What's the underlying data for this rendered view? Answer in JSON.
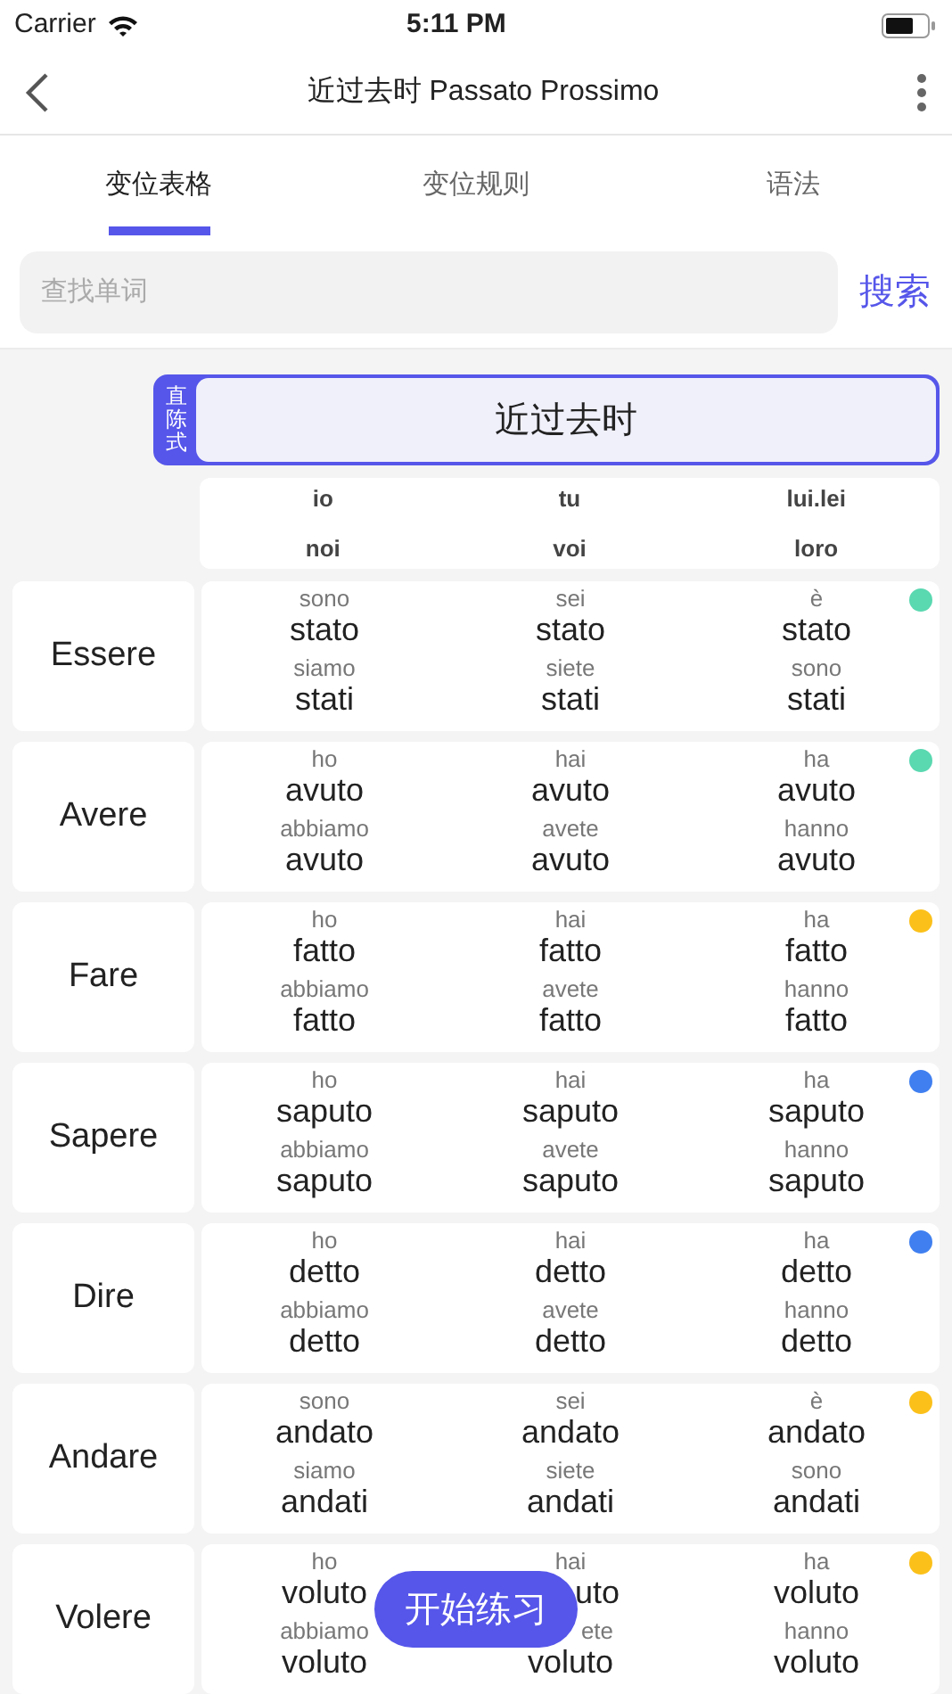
{
  "status_bar": {
    "carrier": "Carrier",
    "time": "5:11 PM"
  },
  "nav": {
    "title": "近过去时 Passato Prossimo"
  },
  "tabs": [
    {
      "label": "变位表格",
      "selected": true
    },
    {
      "label": "变位规则",
      "selected": false
    },
    {
      "label": "语法",
      "selected": false
    }
  ],
  "search": {
    "placeholder": "查找单词",
    "button": "搜索"
  },
  "mood": {
    "tag": "直陈式",
    "tense": "近过去时"
  },
  "persons": [
    [
      "io",
      "tu",
      "lui.lei"
    ],
    [
      "noi",
      "voi",
      "loro"
    ]
  ],
  "verbs": [
    {
      "name": "Essere",
      "color": "#5ad8b0",
      "forms": [
        [
          {
            "aux": "sono",
            "part": "stato"
          },
          {
            "aux": "sei",
            "part": "stato"
          },
          {
            "aux": "è",
            "part": "stato"
          }
        ],
        [
          {
            "aux": "siamo",
            "part": "stati"
          },
          {
            "aux": "siete",
            "part": "stati"
          },
          {
            "aux": "sono",
            "part": "stati"
          }
        ]
      ]
    },
    {
      "name": "Avere",
      "color": "#5ad8b0",
      "forms": [
        [
          {
            "aux": "ho",
            "part": "avuto"
          },
          {
            "aux": "hai",
            "part": "avuto"
          },
          {
            "aux": "ha",
            "part": "avuto"
          }
        ],
        [
          {
            "aux": "abbiamo",
            "part": "avuto"
          },
          {
            "aux": "avete",
            "part": "avuto"
          },
          {
            "aux": "hanno",
            "part": "avuto"
          }
        ]
      ]
    },
    {
      "name": "Fare",
      "color": "#fbc01a",
      "forms": [
        [
          {
            "aux": "ho",
            "part": "fatto"
          },
          {
            "aux": "hai",
            "part": "fatto"
          },
          {
            "aux": "ha",
            "part": "fatto"
          }
        ],
        [
          {
            "aux": "abbiamo",
            "part": "fatto"
          },
          {
            "aux": "avete",
            "part": "fatto"
          },
          {
            "aux": "hanno",
            "part": "fatto"
          }
        ]
      ]
    },
    {
      "name": "Sapere",
      "color": "#3f7ff0",
      "forms": [
        [
          {
            "aux": "ho",
            "part": "saputo"
          },
          {
            "aux": "hai",
            "part": "saputo"
          },
          {
            "aux": "ha",
            "part": "saputo"
          }
        ],
        [
          {
            "aux": "abbiamo",
            "part": "saputo"
          },
          {
            "aux": "avete",
            "part": "saputo"
          },
          {
            "aux": "hanno",
            "part": "saputo"
          }
        ]
      ]
    },
    {
      "name": "Dire",
      "color": "#3f7ff0",
      "forms": [
        [
          {
            "aux": "ho",
            "part": "detto"
          },
          {
            "aux": "hai",
            "part": "detto"
          },
          {
            "aux": "ha",
            "part": "detto"
          }
        ],
        [
          {
            "aux": "abbiamo",
            "part": "detto"
          },
          {
            "aux": "avete",
            "part": "detto"
          },
          {
            "aux": "hanno",
            "part": "detto"
          }
        ]
      ]
    },
    {
      "name": "Andare",
      "color": "#fbc01a",
      "forms": [
        [
          {
            "aux": "sono",
            "part": "andato"
          },
          {
            "aux": "sei",
            "part": "andato"
          },
          {
            "aux": "è",
            "part": "andato"
          }
        ],
        [
          {
            "aux": "siamo",
            "part": "andati"
          },
          {
            "aux": "siete",
            "part": "andati"
          },
          {
            "aux": "sono",
            "part": "andati"
          }
        ]
      ]
    },
    {
      "name": "Volere",
      "color": "#fbc01a",
      "forms": [
        [
          {
            "aux": "ho",
            "part": "voluto"
          },
          {
            "aux": "hai",
            "part": "uto",
            "covered": true
          },
          {
            "aux": "ha",
            "part": "voluto"
          }
        ],
        [
          {
            "aux": "abbiamo",
            "part": "voluto"
          },
          {
            "aux": "ete",
            "part": "voluto",
            "covered": true
          },
          {
            "aux": "hanno",
            "part": "voluto"
          }
        ]
      ]
    }
  ],
  "practice_button": "开始练习"
}
